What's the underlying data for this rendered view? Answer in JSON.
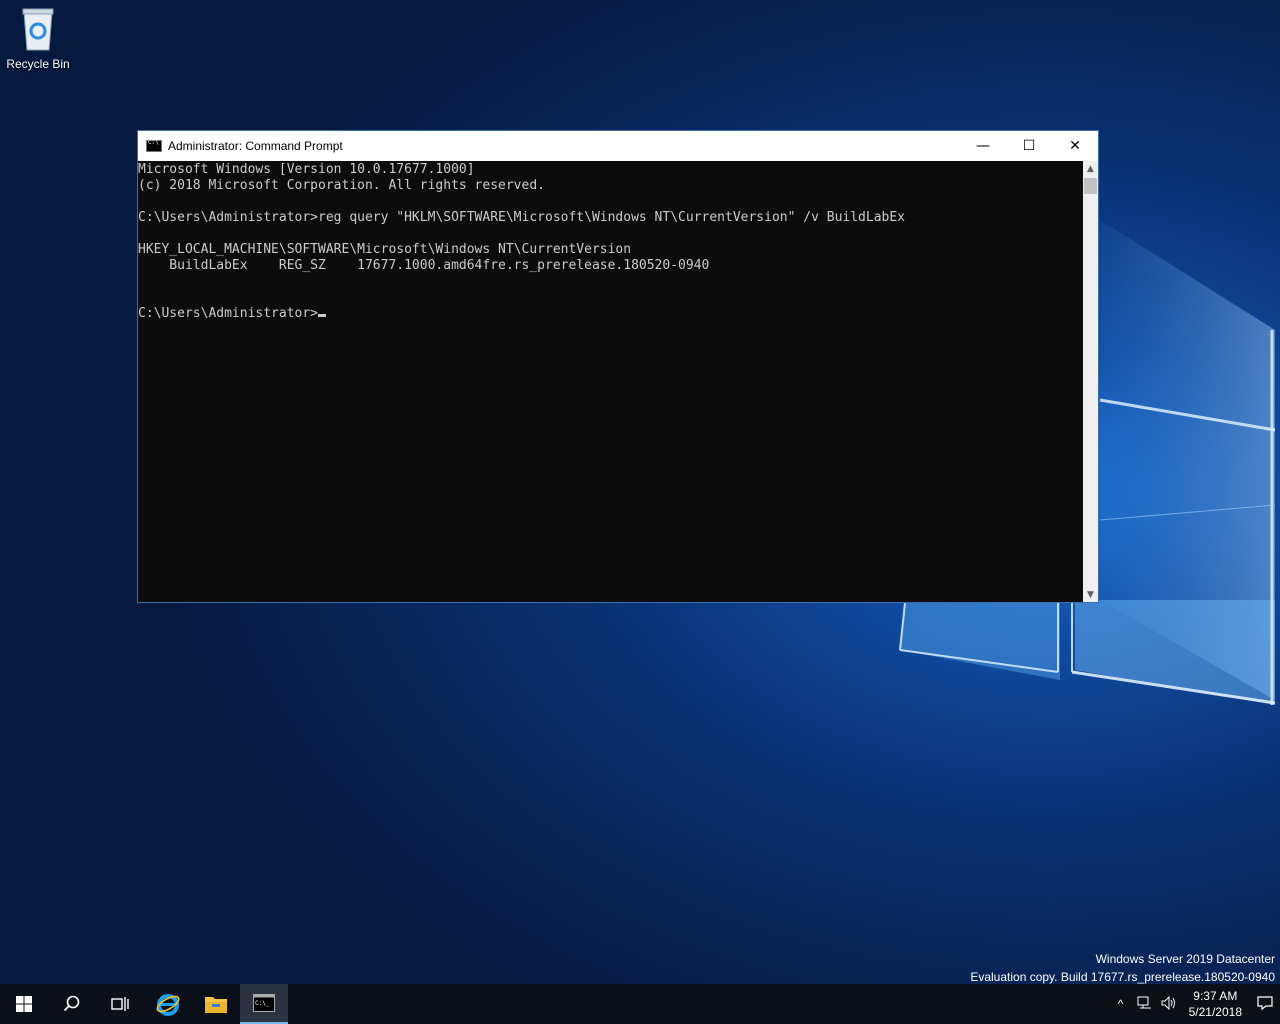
{
  "desktop": {
    "recycle_bin_label": "Recycle Bin"
  },
  "window": {
    "title": "Administrator: Command Prompt",
    "controls": {
      "minimize": "—",
      "maximize": "☐",
      "close": "✕"
    },
    "console_lines": [
      "Microsoft Windows [Version 10.0.17677.1000]",
      "(c) 2018 Microsoft Corporation. All rights reserved.",
      "",
      "C:\\Users\\Administrator>reg query \"HKLM\\SOFTWARE\\Microsoft\\Windows NT\\CurrentVersion\" /v BuildLabEx",
      "",
      "HKEY_LOCAL_MACHINE\\SOFTWARE\\Microsoft\\Windows NT\\CurrentVersion",
      "    BuildLabEx    REG_SZ    17677.1000.amd64fre.rs_prerelease.180520-0940",
      "",
      ""
    ],
    "prompt": "C:\\Users\\Administrator>"
  },
  "watermark": {
    "line1": "Windows Server 2019 Datacenter",
    "line2": "Evaluation copy. Build 17677.rs_prerelease.180520-0940"
  },
  "taskbar": {
    "start_icon": "windows-logo-icon",
    "search_icon": "search-icon",
    "task_view_icon": "task-view-icon",
    "apps": [
      "internet-explorer-icon",
      "file-explorer-icon",
      "command-prompt-icon"
    ],
    "tray": {
      "chevron": "^",
      "time": "9:37 AM",
      "date": "5/21/2018"
    }
  },
  "colors": {
    "console_bg": "#0c0c0c",
    "console_text": "#cccccc",
    "taskbar_bg": "#0a0f18",
    "accent": "#76b9ed"
  }
}
